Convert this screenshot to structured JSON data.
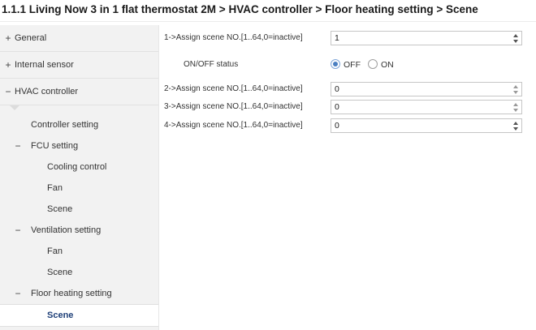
{
  "breadcrumb": "1.1.1 Living Now 3 in 1 flat thermostat 2M > HVAC controller > Floor heating setting > Scene",
  "sidebar": {
    "top_items": [
      {
        "sign": "+",
        "label": "General"
      },
      {
        "sign": "+",
        "label": "Internal sensor"
      },
      {
        "sign": "−",
        "label": "HVAC controller"
      }
    ],
    "sub_items": [
      {
        "sign": "",
        "label": "Controller setting"
      },
      {
        "sign": "−",
        "label": "FCU setting"
      },
      {
        "sign": "",
        "label": "Cooling control"
      },
      {
        "sign": "",
        "label": "Fan"
      },
      {
        "sign": "",
        "label": "Scene"
      },
      {
        "sign": "−",
        "label": "Ventilation setting"
      },
      {
        "sign": "",
        "label": "Fan"
      },
      {
        "sign": "",
        "label": "Scene"
      },
      {
        "sign": "−",
        "label": "Floor heating setting"
      },
      {
        "sign": "",
        "label": "Scene",
        "active": true
      }
    ]
  },
  "params": [
    {
      "label": "1->Assign scene NO.[1..64,0=inactive]",
      "value": "1"
    },
    {
      "label": "ON/OFF status",
      "options": [
        "OFF",
        "ON"
      ],
      "selected": "OFF"
    },
    {
      "label": "2->Assign scene NO.[1..64,0=inactive]",
      "value": "0"
    },
    {
      "label": "3->Assign scene NO.[1..64,0=inactive]",
      "value": "0"
    },
    {
      "label": "4->Assign scene NO.[1..64,0=inactive]",
      "value": "0"
    }
  ],
  "colors": {
    "active_text": "#1e3f78",
    "radio_selected": "#4a7fc1",
    "sidebar_bg": "#f2f2f2"
  }
}
